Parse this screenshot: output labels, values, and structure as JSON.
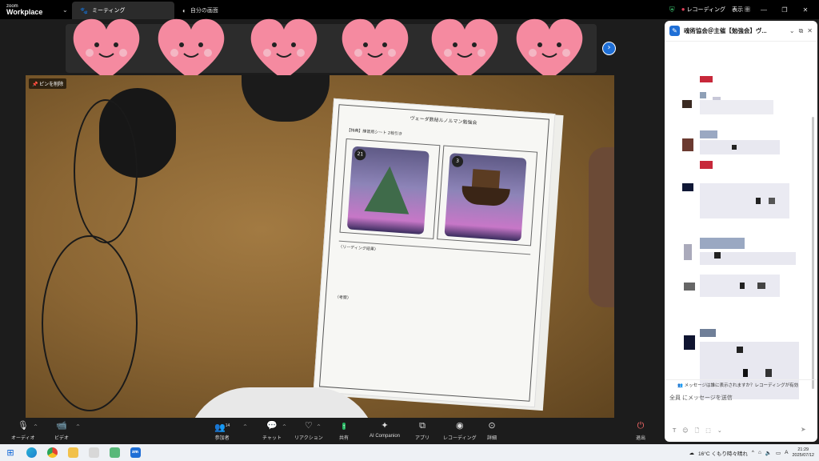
{
  "titlebar": {
    "brand_small": "zoom",
    "brand_large": "Workplace",
    "tabs": [
      {
        "label": "ミーティング",
        "icon": "paw-icon"
      },
      {
        "label": "自分の画面",
        "icon": "moon-icon"
      }
    ],
    "recording_label": "レコーディング",
    "view_label": "表示"
  },
  "video": {
    "pin_label": "ピンを削除",
    "paper_title": "ヴェーダ数秘ルノルマン勉強会",
    "paper_subtitle": "【特典】練習用シート 2枚引き",
    "card1_number": "21",
    "card2_number": "3",
    "section_reading": "〈リーディング結果〉",
    "section_notes": "〈考察〉"
  },
  "toolbar": {
    "audio": "オーディオ",
    "video": "ビデオ",
    "participants": "参加者",
    "participants_count": "14",
    "chat": "チャット",
    "reaction": "リアクション",
    "share": "共有",
    "ai": "AI Companion",
    "apps": "アプリ",
    "recording": "レコーディング",
    "more": "詳細",
    "leave": "退出"
  },
  "chat": {
    "title": "魂術協会＠主催【勉強会】ヴ...",
    "notice": "メッセージは誰に表示されますか？レコーディングが有効",
    "input_placeholder": "全員 にメッセージを送信"
  },
  "taskbar": {
    "weather": "16°C くもり時々晴れ",
    "ime": "A",
    "time": "21:29",
    "date": "2025/07/12"
  }
}
